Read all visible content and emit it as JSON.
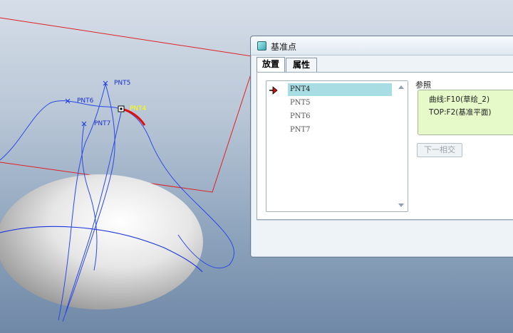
{
  "viewport": {
    "points": [
      {
        "name": "PNT5",
        "active": false
      },
      {
        "name": "PNT6",
        "active": false
      },
      {
        "name": "PNT4",
        "active": true
      },
      {
        "name": "PNT7",
        "active": false
      }
    ],
    "colors": {
      "curve": "#1a35e0",
      "plane": "#e02020",
      "active_point": "#ffff00",
      "selected_edge": "#e01010"
    }
  },
  "dialog": {
    "title": "基准点",
    "icon": "datum-point-dialog-icon",
    "tabs": [
      {
        "label": "放置",
        "active": true
      },
      {
        "label": "属性",
        "active": false
      }
    ],
    "placement": {
      "points": [
        {
          "label": "PNT4",
          "selected": true
        },
        {
          "label": "PNT5",
          "selected": false
        },
        {
          "label": "PNT6",
          "selected": false
        },
        {
          "label": "PNT7",
          "selected": false
        }
      ],
      "references_label": "参照",
      "references": [
        "曲线:F10(草绘_2)",
        "TOP:F2(基准平面)"
      ],
      "next_intersection_label": "下一相交"
    }
  }
}
